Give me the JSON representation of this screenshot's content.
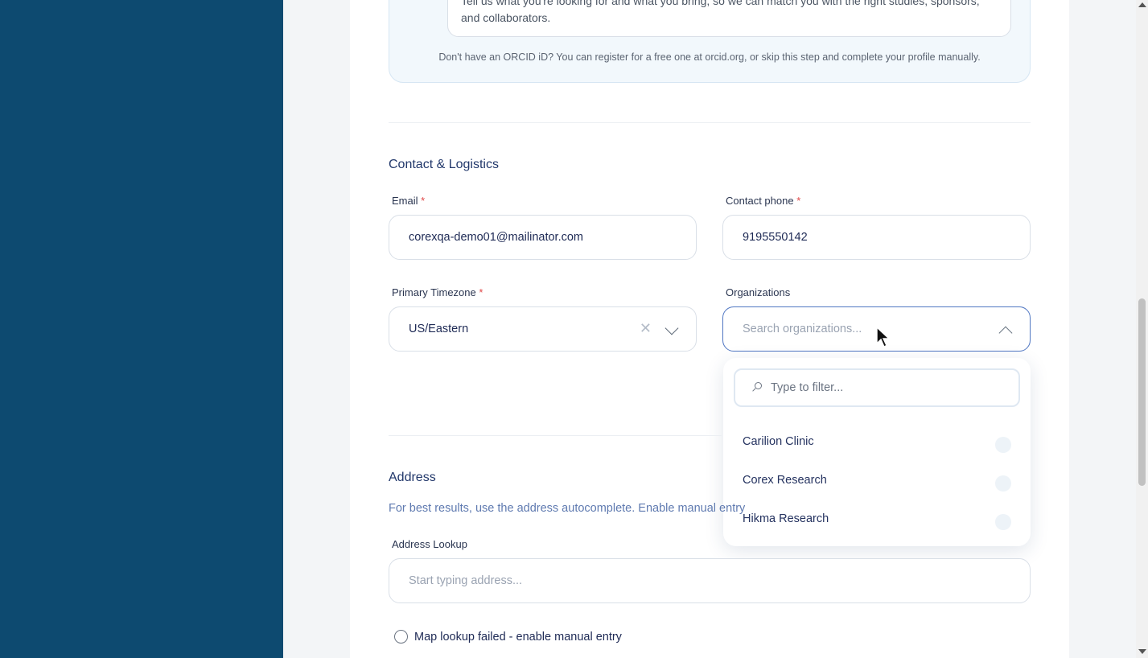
{
  "profile": {
    "bio_text": "Tell us what you're looking for and what you bring, so we can match you with the right studies, sponsors, and collaborators.",
    "orcid_note": "Don't have an ORCID iD? You can register for a free one at orcid.org, or skip this step and complete your profile manually."
  },
  "contact": {
    "title": "Contact & Logistics",
    "email_label": "Email",
    "email_value": "corexqa-demo01@mailinator.com",
    "phone_label": "Contact phone",
    "phone_value": "9195550142",
    "timezone_label": "Primary Timezone",
    "timezone_value": "US/Eastern",
    "organizations_label": "Organizations",
    "organizations_placeholder": "Search organizations...",
    "required_mark": "*"
  },
  "org_dropdown": {
    "filter_placeholder": "Type to filter...",
    "options": [
      "Carilion Clinic",
      "Corex Research",
      "Hikma Research"
    ]
  },
  "address": {
    "title": "Address",
    "hint": "For best results, use the address autocomplete. Enable manual entry",
    "lookup_label": "Address Lookup",
    "lookup_placeholder": "Start typing address...",
    "manual_checkbox_label": "Map lookup failed - enable manual entry"
  },
  "icons": {
    "clear": "close-icon",
    "select_chevron": "chevron-down-icon",
    "open_chevron": "chevron-up-icon",
    "filter_search": "search-icon"
  },
  "colors": {
    "sidebar": "#0d4a70",
    "heading": "#22386b",
    "required": "#e04848",
    "focus_border": "#4f76c2"
  }
}
